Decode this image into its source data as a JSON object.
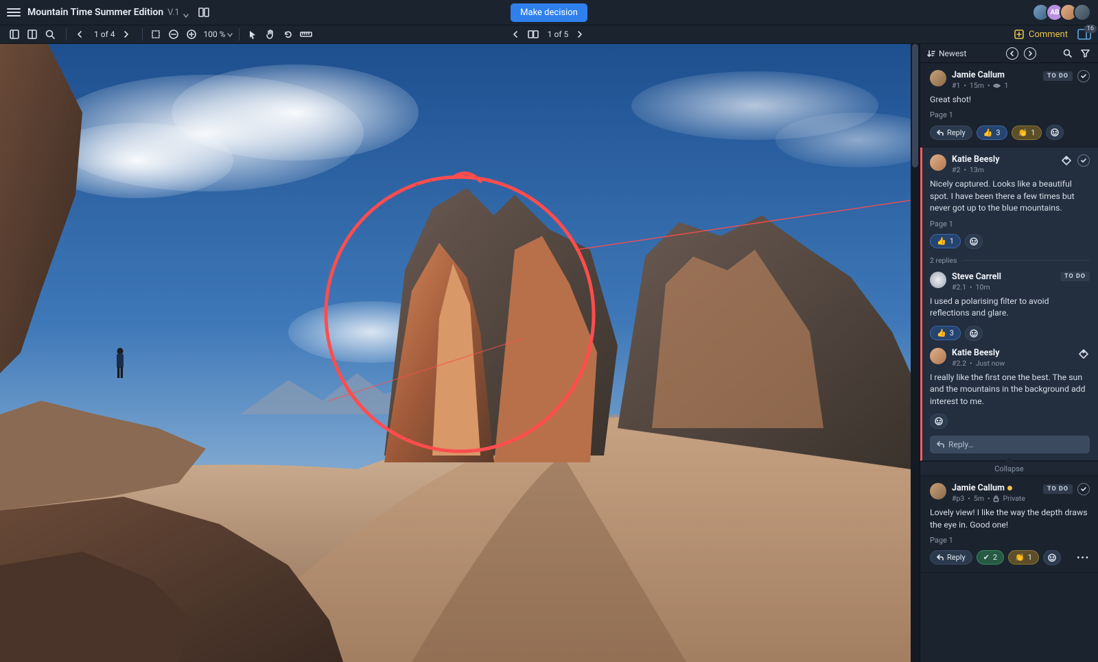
{
  "header": {
    "title": "Mountain Time Summer Edition",
    "version": "V.1",
    "make_decision": "Make decision",
    "avatars": [
      {
        "label": "",
        "bg": "linear-gradient(135deg,#7aa0c4,#39617f)"
      },
      {
        "label": "AB",
        "bg": "#b98fe0"
      },
      {
        "label": "",
        "bg": "linear-gradient(135deg,#e0b089,#b07850)"
      },
      {
        "label": "",
        "bg": "linear-gradient(135deg,#6b7c8c,#3a4a58)"
      }
    ]
  },
  "toolbar": {
    "page_of": "1 of 4",
    "spread_of": "1 of 5",
    "zoom": "100 %",
    "comment_label": "Comment",
    "batch_count": "16"
  },
  "sidebar": {
    "sort": "Newest",
    "collapse": "Collapse",
    "reply_placeholder": "Reply…"
  },
  "comments": [
    {
      "name": "Jamie Callum",
      "meta_id": "#1",
      "meta_time": "15m",
      "meta_views": "1",
      "todo": "TO DO",
      "text": "Great shot!",
      "page": "Page 1",
      "reply_label": "Reply",
      "reactions": [
        {
          "icon": "👍",
          "count": "3",
          "cls": "blue"
        },
        {
          "icon": "👏",
          "count": "1",
          "cls": "yellow"
        }
      ],
      "avatar": "linear-gradient(135deg,#c8a078,#8a6a4a)"
    },
    {
      "name": "Katie Beesly",
      "meta_id": "#2",
      "meta_time": "13m",
      "text": "Nicely captured. Looks like a beautiful spot. I have been there a few times but never got up to the blue mountains.",
      "page": "Page 1",
      "reactions": [
        {
          "icon": "👍",
          "count": "1",
          "cls": "blue"
        }
      ],
      "replies_label": "2 replies",
      "avatar": "linear-gradient(135deg,#e0b089,#b07850)",
      "thread": [
        {
          "name": "Steve Carrell",
          "meta_id": "#2.1",
          "meta_time": "10m",
          "todo": "TO DO",
          "text": "I used a polarising filter to avoid reflections and glare.",
          "reactions": [
            {
              "icon": "👍",
              "count": "3",
              "cls": "blue"
            }
          ],
          "avatar": "radial-gradient(circle,#eceff3,#9aa4b0)"
        },
        {
          "name": "Katie Beesly",
          "meta_id": "#2.2",
          "meta_time": "Just now",
          "text": "I really like the first one the best. The sun and the mountains in the background add interest to me.",
          "avatar": "linear-gradient(135deg,#e0b089,#b07850)"
        }
      ]
    },
    {
      "name": "Jamie Callum",
      "meta_id": "#p3",
      "meta_time": "5m",
      "private": "Private",
      "todo": "TO DO",
      "status_dot": true,
      "text": "Lovely view! I like the way the depth draws the eye in. Good one!",
      "page": "Page 1",
      "reply_label": "Reply",
      "reactions": [
        {
          "icon": "✔",
          "count": "2",
          "cls": "green"
        },
        {
          "icon": "👏",
          "count": "1",
          "cls": "yellow"
        }
      ],
      "avatar": "linear-gradient(135deg,#c8a078,#8a6a4a)"
    }
  ]
}
